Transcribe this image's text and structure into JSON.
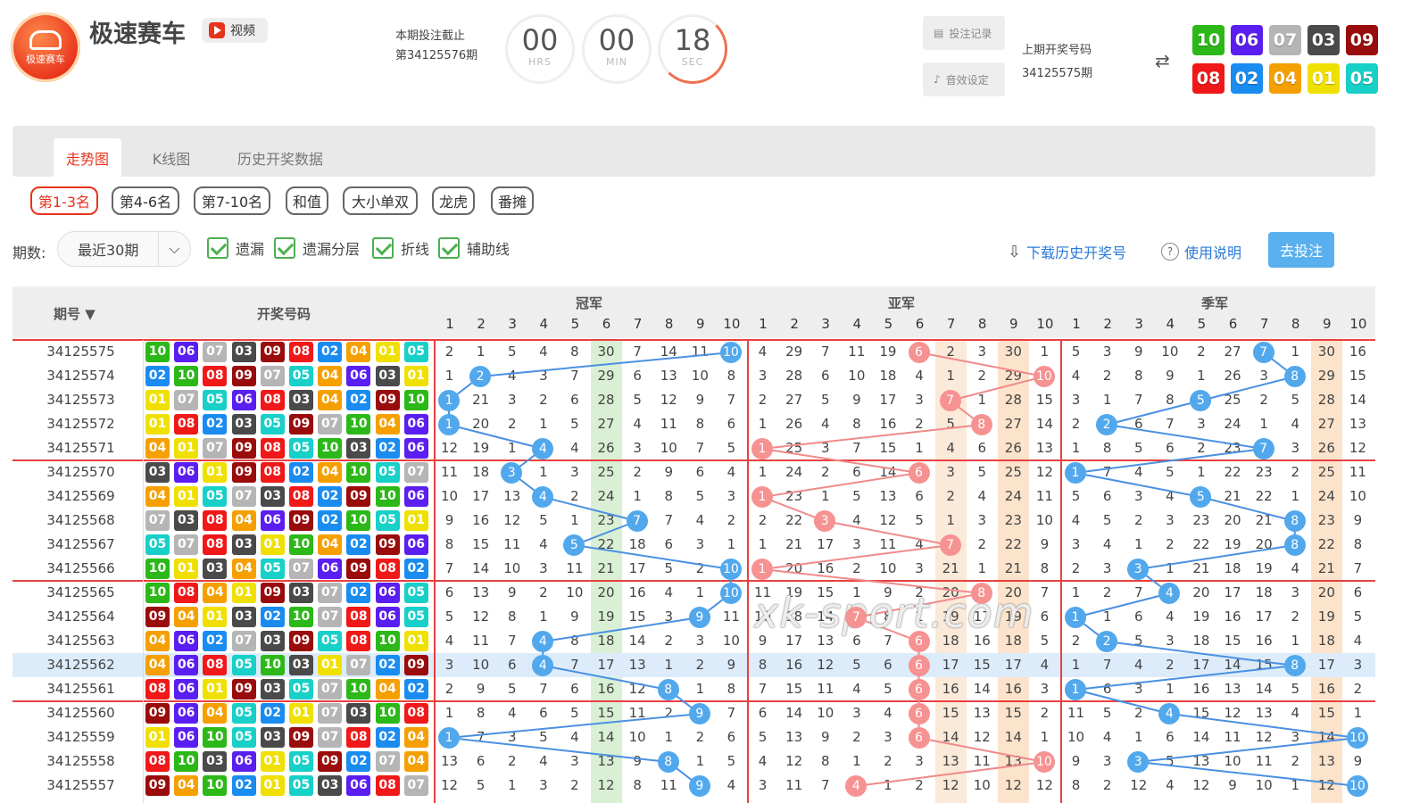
{
  "app": {
    "title": "极速赛车",
    "logo_text": "极速赛车",
    "video_label": "视频"
  },
  "deadline": {
    "line1": "本期投注截止",
    "line2": "第34125576期"
  },
  "countdown": [
    {
      "value": "00",
      "unit": "HRS"
    },
    {
      "value": "00",
      "unit": "MIN"
    },
    {
      "value": "18",
      "unit": "SEC"
    }
  ],
  "actions": {
    "bet_record": "投注记录",
    "sound_settings": "音效设定"
  },
  "last_draw": {
    "label": "上期开奖号码",
    "issue": "34125575期",
    "swap_icon": "⇄",
    "numbers": [
      "10",
      "06",
      "07",
      "03",
      "09",
      "08",
      "02",
      "04",
      "01",
      "05"
    ]
  },
  "number_colors": {
    "01": "#f0e000",
    "02": "#1a8cf0",
    "03": "#4a4a4a",
    "04": "#f5a000",
    "05": "#18d0c8",
    "06": "#5a1ef0",
    "07": "#b5b5b5",
    "08": "#f01818",
    "09": "#9a0c0c",
    "10": "#2cb818"
  },
  "tabs": [
    "走势图",
    "K线图",
    "历史开奖数据"
  ],
  "filters": [
    "第1-3名",
    "第4-6名",
    "第7-10名",
    "和值",
    "大小单双",
    "龙虎",
    "番摊"
  ],
  "controls": {
    "period_label": "期数:",
    "period_value": "最近30期",
    "checks": [
      "遗漏",
      "遗漏分层",
      "折线",
      "辅助线"
    ],
    "download": "下载历史开奖号",
    "help": "使用说明",
    "go_bet": "去投注"
  },
  "table": {
    "col_issue": "期号",
    "sort_icon": "▼",
    "col_numbers": "开奖号码",
    "groups": [
      "冠军",
      "亚军",
      "季军"
    ],
    "positions": [
      "1",
      "2",
      "3",
      "4",
      "5",
      "6",
      "7",
      "8",
      "9",
      "10"
    ],
    "rows": [
      {
        "issue": "34125575",
        "nums": [
          "10",
          "06",
          "07",
          "03",
          "09",
          "08",
          "02",
          "04",
          "01",
          "05"
        ],
        "g": [
          [
            2,
            1,
            5,
            4,
            8,
            30,
            7,
            14,
            11,
            10
          ],
          [
            4,
            29,
            7,
            11,
            19,
            6,
            2,
            3,
            30,
            1
          ],
          [
            5,
            3,
            9,
            10,
            2,
            27,
            7,
            1,
            30,
            16
          ]
        ]
      },
      {
        "issue": "34125574",
        "nums": [
          "02",
          "10",
          "08",
          "09",
          "07",
          "05",
          "04",
          "06",
          "03",
          "01"
        ],
        "g": [
          [
            1,
            2,
            4,
            3,
            7,
            29,
            6,
            13,
            10,
            8
          ],
          [
            3,
            28,
            6,
            10,
            18,
            4,
            1,
            2,
            29,
            10
          ],
          [
            4,
            2,
            8,
            9,
            1,
            26,
            3,
            8,
            29,
            15
          ]
        ]
      },
      {
        "issue": "34125573",
        "nums": [
          "01",
          "07",
          "05",
          "06",
          "08",
          "03",
          "04",
          "02",
          "09",
          "10"
        ],
        "g": [
          [
            1,
            21,
            3,
            2,
            6,
            28,
            5,
            12,
            9,
            7
          ],
          [
            2,
            27,
            5,
            9,
            17,
            3,
            7,
            1,
            28,
            15
          ],
          [
            3,
            1,
            7,
            8,
            5,
            25,
            2,
            5,
            28,
            14
          ]
        ]
      },
      {
        "issue": "34125572",
        "nums": [
          "01",
          "08",
          "02",
          "03",
          "05",
          "09",
          "07",
          "10",
          "04",
          "06"
        ],
        "g": [
          [
            1,
            20,
            2,
            1,
            5,
            27,
            4,
            11,
            8,
            6
          ],
          [
            1,
            26,
            4,
            8,
            16,
            2,
            5,
            8,
            27,
            14
          ],
          [
            2,
            2,
            6,
            7,
            3,
            24,
            1,
            4,
            27,
            13
          ]
        ]
      },
      {
        "issue": "34125571",
        "nums": [
          "04",
          "01",
          "07",
          "09",
          "08",
          "05",
          "10",
          "03",
          "02",
          "06"
        ],
        "g": [
          [
            12,
            19,
            1,
            4,
            4,
            26,
            3,
            10,
            7,
            5
          ],
          [
            1,
            25,
            3,
            7,
            15,
            1,
            4,
            6,
            26,
            13
          ],
          [
            1,
            8,
            5,
            6,
            2,
            23,
            7,
            3,
            26,
            12
          ]
        ]
      },
      {
        "issue": "34125570",
        "nums": [
          "03",
          "06",
          "01",
          "09",
          "08",
          "02",
          "04",
          "10",
          "05",
          "07"
        ],
        "g": [
          [
            11,
            18,
            3,
            1,
            3,
            25,
            2,
            9,
            6,
            4
          ],
          [
            1,
            24,
            2,
            6,
            14,
            6,
            3,
            5,
            25,
            12
          ],
          [
            1,
            7,
            4,
            5,
            1,
            22,
            23,
            2,
            25,
            11
          ]
        ]
      },
      {
        "issue": "34125569",
        "nums": [
          "04",
          "01",
          "05",
          "07",
          "03",
          "08",
          "02",
          "09",
          "10",
          "06"
        ],
        "g": [
          [
            10,
            17,
            13,
            4,
            2,
            24,
            1,
            8,
            5,
            3
          ],
          [
            1,
            23,
            1,
            5,
            13,
            6,
            2,
            4,
            24,
            11
          ],
          [
            5,
            6,
            3,
            4,
            5,
            21,
            22,
            1,
            24,
            10
          ]
        ]
      },
      {
        "issue": "34125568",
        "nums": [
          "07",
          "03",
          "08",
          "04",
          "06",
          "09",
          "02",
          "10",
          "05",
          "01"
        ],
        "g": [
          [
            9,
            16,
            12,
            5,
            1,
            23,
            7,
            7,
            4,
            2
          ],
          [
            2,
            22,
            3,
            4,
            12,
            5,
            1,
            3,
            23,
            10
          ],
          [
            4,
            5,
            2,
            3,
            23,
            20,
            21,
            8,
            23,
            9
          ]
        ]
      },
      {
        "issue": "34125567",
        "nums": [
          "05",
          "07",
          "08",
          "03",
          "01",
          "10",
          "04",
          "02",
          "09",
          "06"
        ],
        "g": [
          [
            8,
            15,
            11,
            4,
            5,
            22,
            18,
            6,
            3,
            1
          ],
          [
            1,
            21,
            17,
            3,
            11,
            4,
            7,
            2,
            22,
            9
          ],
          [
            3,
            4,
            1,
            2,
            22,
            19,
            20,
            8,
            22,
            8
          ]
        ]
      },
      {
        "issue": "34125566",
        "nums": [
          "10",
          "01",
          "03",
          "04",
          "05",
          "07",
          "06",
          "09",
          "08",
          "02"
        ],
        "g": [
          [
            7,
            14,
            10,
            3,
            11,
            21,
            17,
            5,
            2,
            10
          ],
          [
            1,
            20,
            16,
            2,
            10,
            3,
            21,
            1,
            21,
            8
          ],
          [
            2,
            3,
            3,
            1,
            21,
            18,
            19,
            4,
            21,
            7
          ]
        ]
      },
      {
        "issue": "34125565",
        "nums": [
          "10",
          "08",
          "04",
          "01",
          "09",
          "03",
          "07",
          "02",
          "06",
          "05"
        ],
        "g": [
          [
            6,
            13,
            9,
            2,
            10,
            20,
            16,
            4,
            1,
            10
          ],
          [
            11,
            19,
            15,
            1,
            9,
            2,
            20,
            8,
            20,
            7
          ],
          [
            1,
            2,
            7,
            4,
            20,
            17,
            18,
            3,
            20,
            6
          ]
        ]
      },
      {
        "issue": "34125564",
        "nums": [
          "09",
          "04",
          "01",
          "03",
          "02",
          "10",
          "07",
          "08",
          "06",
          "05"
        ],
        "g": [
          [
            5,
            12,
            8,
            1,
            9,
            19,
            15,
            3,
            9,
            11
          ],
          [
            10,
            18,
            14,
            7,
            8,
            1,
            19,
            17,
            19,
            6
          ],
          [
            1,
            1,
            6,
            4,
            19,
            16,
            17,
            2,
            19,
            5
          ]
        ]
      },
      {
        "issue": "34125563",
        "nums": [
          "04",
          "06",
          "02",
          "07",
          "03",
          "09",
          "05",
          "08",
          "10",
          "01"
        ],
        "g": [
          [
            4,
            11,
            7,
            4,
            8,
            18,
            14,
            2,
            3,
            10
          ],
          [
            9,
            17,
            13,
            6,
            7,
            6,
            18,
            16,
            18,
            5
          ],
          [
            2,
            2,
            5,
            3,
            18,
            15,
            16,
            1,
            18,
            4
          ]
        ]
      },
      {
        "issue": "34125562",
        "nums": [
          "04",
          "06",
          "08",
          "05",
          "10",
          "03",
          "01",
          "07",
          "02",
          "09"
        ],
        "g": [
          [
            3,
            10,
            6,
            4,
            7,
            17,
            13,
            1,
            2,
            9
          ],
          [
            8,
            16,
            12,
            5,
            6,
            6,
            17,
            15,
            17,
            4
          ],
          [
            1,
            7,
            4,
            2,
            17,
            14,
            15,
            8,
            17,
            3
          ]
        ]
      },
      {
        "issue": "34125561",
        "nums": [
          "08",
          "06",
          "01",
          "09",
          "03",
          "05",
          "07",
          "10",
          "04",
          "02"
        ],
        "g": [
          [
            2,
            9,
            5,
            7,
            6,
            16,
            12,
            8,
            1,
            8
          ],
          [
            7,
            15,
            11,
            4,
            5,
            6,
            16,
            14,
            16,
            3
          ],
          [
            1,
            6,
            3,
            1,
            16,
            13,
            14,
            5,
            16,
            2
          ]
        ]
      },
      {
        "issue": "34125560",
        "nums": [
          "09",
          "06",
          "04",
          "05",
          "02",
          "01",
          "07",
          "03",
          "10",
          "08"
        ],
        "g": [
          [
            1,
            8,
            4,
            6,
            5,
            15,
            11,
            2,
            9,
            7
          ],
          [
            6,
            14,
            10,
            3,
            4,
            6,
            15,
            13,
            15,
            2
          ],
          [
            11,
            5,
            2,
            4,
            15,
            12,
            13,
            4,
            15,
            1
          ]
        ]
      },
      {
        "issue": "34125559",
        "nums": [
          "01",
          "06",
          "10",
          "05",
          "03",
          "09",
          "07",
          "08",
          "02",
          "04"
        ],
        "g": [
          [
            1,
            7,
            3,
            5,
            4,
            14,
            10,
            1,
            2,
            6
          ],
          [
            5,
            13,
            9,
            2,
            3,
            6,
            14,
            12,
            14,
            1
          ],
          [
            10,
            4,
            1,
            6,
            14,
            11,
            12,
            3,
            14,
            10
          ]
        ]
      },
      {
        "issue": "34125558",
        "nums": [
          "08",
          "10",
          "03",
          "06",
          "01",
          "05",
          "09",
          "02",
          "07",
          "04"
        ],
        "g": [
          [
            13,
            6,
            2,
            4,
            3,
            13,
            9,
            8,
            1,
            5
          ],
          [
            4,
            12,
            8,
            1,
            2,
            3,
            13,
            11,
            13,
            10
          ],
          [
            9,
            3,
            3,
            5,
            13,
            10,
            11,
            2,
            13,
            9
          ]
        ]
      },
      {
        "issue": "34125557",
        "nums": [
          "09",
          "04",
          "10",
          "02",
          "01",
          "05",
          "03",
          "06",
          "08",
          "07"
        ],
        "g": [
          [
            12,
            5,
            1,
            3,
            2,
            12,
            8,
            11,
            9,
            4
          ],
          [
            3,
            11,
            7,
            4,
            1,
            2,
            12,
            10,
            12,
            12
          ],
          [
            8,
            2,
            12,
            4,
            12,
            9,
            10,
            1,
            12,
            10
          ]
        ]
      }
    ]
  },
  "watermark": "xk-sport.com"
}
